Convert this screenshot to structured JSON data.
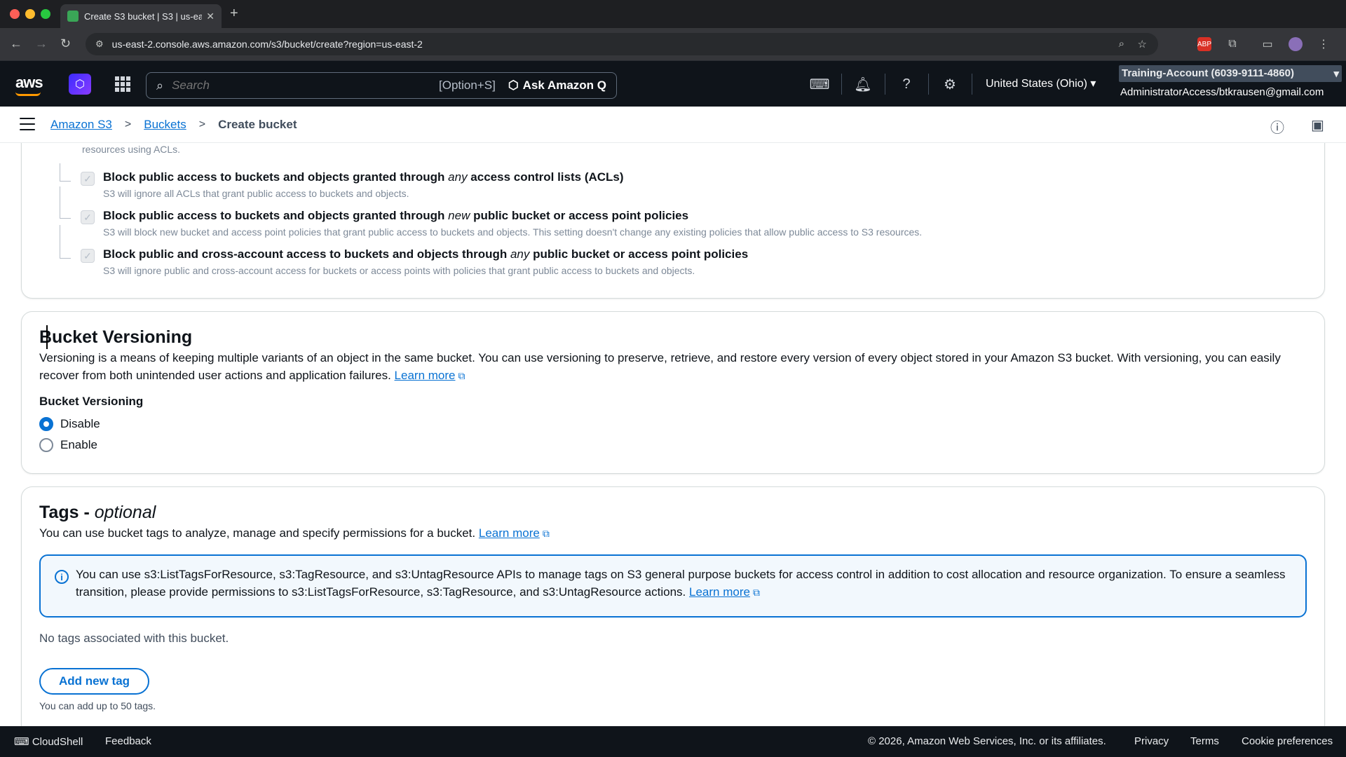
{
  "browser": {
    "tab_title": "Create S3 bucket | S3 | us-ea",
    "url": "us-east-2.console.aws.amazon.com/s3/bucket/create?region=us-east-2"
  },
  "aws_header": {
    "logo_text": "aws",
    "search_placeholder": "Search",
    "search_shortcut": "[Option+S]",
    "ask_q_label": "Ask Amazon Q",
    "region_label": "United States (Ohio)",
    "account_name": "Training-Account (6039-9111-4860)",
    "account_user": "AdministratorAccess/btkrausen@gmail.com"
  },
  "breadcrumb": {
    "items": [
      "Amazon S3",
      "Buckets"
    ],
    "current": "Create bucket"
  },
  "acl_section": {
    "cut_text": "resources using ACLs.",
    "options": [
      {
        "title_pre": "Block public access to buckets and objects granted through ",
        "title_em": "any",
        "title_post": " access control lists (ACLs)",
        "desc": "S3 will ignore all ACLs that grant public access to buckets and objects."
      },
      {
        "title_pre": "Block public access to buckets and objects granted through ",
        "title_em": "new",
        "title_post": " public bucket or access point policies",
        "desc": "S3 will block new bucket and access point policies that grant public access to buckets and objects. This setting doesn't change any existing policies that allow public access to S3 resources."
      },
      {
        "title_pre": "Block public and cross-account access to buckets and objects through ",
        "title_em": "any",
        "title_post": " public bucket or access point policies",
        "desc": "S3 will ignore public and cross-account access for buckets or access points with policies that grant public access to buckets and objects."
      }
    ]
  },
  "versioning": {
    "heading": "Bucket Versioning",
    "description": "Versioning is a means of keeping multiple variants of an object in the same bucket. You can use versioning to preserve, retrieve, and restore every version of every object stored in your Amazon S3 bucket. With versioning, you can easily recover from both unintended user actions and application failures.",
    "learn_more": "Learn more",
    "field_label": "Bucket Versioning",
    "options": [
      "Disable",
      "Enable"
    ],
    "selected": "Disable"
  },
  "tags": {
    "heading": "Tags -",
    "heading_em": "optional",
    "description": "You can use bucket tags to analyze, manage and specify permissions for a bucket.",
    "learn_more": "Learn more",
    "info_text": "You can use s3:ListTagsForResource, s3:TagResource, and s3:UntagResource APIs to manage tags on S3 general purpose buckets for access control in addition to cost allocation and resource organization. To ensure a seamless transition, please provide permissions to s3:ListTagsForResource, s3:TagResource, and s3:UntagResource actions.",
    "info_learn_more": "Learn more",
    "empty_text": "No tags associated with this bucket.",
    "add_button": "Add new tag",
    "limit_note": "You can add up to 50 tags."
  },
  "footer": {
    "cloudshell": "CloudShell",
    "feedback": "Feedback",
    "copyright": "© 2026, Amazon Web Services, Inc. or its affiliates.",
    "privacy": "Privacy",
    "terms": "Terms",
    "cookies": "Cookie preferences"
  },
  "colors": {
    "link": "#0972d3",
    "header_bg": "#0f141a",
    "info_bg": "#f2f8fd"
  }
}
